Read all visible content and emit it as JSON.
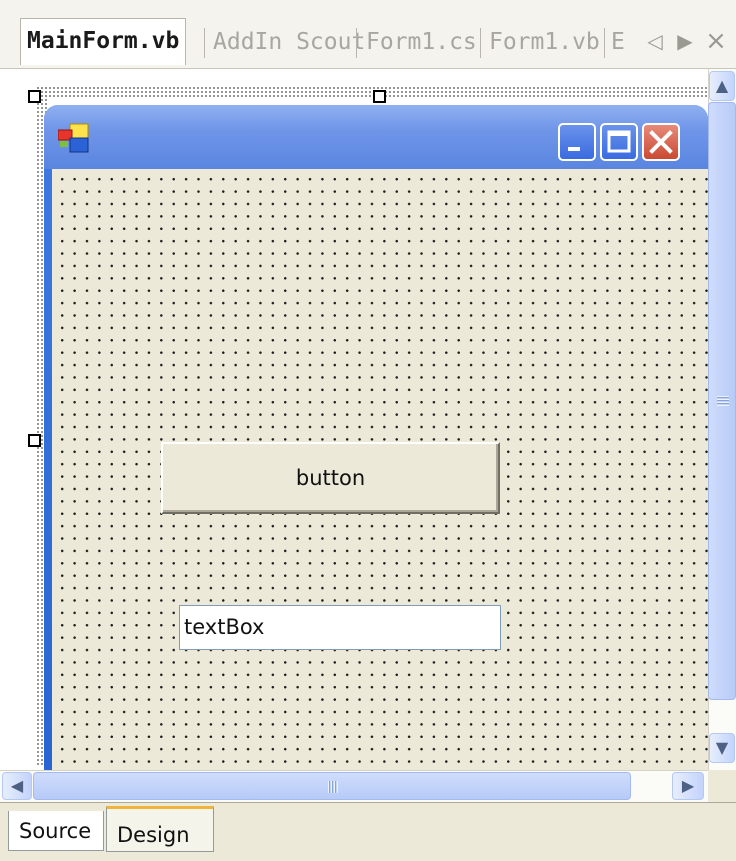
{
  "document_tabs": [
    {
      "label": "MainForm.vb",
      "active": true
    },
    {
      "label": "AddIn Scout",
      "active": false
    },
    {
      "label": "Form1.cs",
      "active": false
    },
    {
      "label": "Form1.vb",
      "active": false
    },
    {
      "label": "E",
      "active": false
    }
  ],
  "tab_strip_buttons": {
    "scroll_left": "◁",
    "scroll_right": "▶",
    "close": "×"
  },
  "form_controls": {
    "button_label": "button",
    "textbox_value": "textBox"
  },
  "scrollbars": {
    "up_arrow": "▲",
    "down_arrow": "▼",
    "left_arrow": "◀",
    "right_arrow": "▶"
  },
  "view_tabs": [
    {
      "label": "Source",
      "active": false
    },
    {
      "label": "Design",
      "active": true
    }
  ],
  "colors": {
    "title_bar": "#6f95e8",
    "form_background": "#ece9d8",
    "close_button": "#c94a32",
    "active_tab_marker": "#f0b43c"
  }
}
